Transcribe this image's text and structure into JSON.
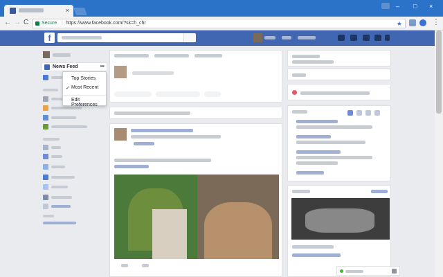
{
  "browser": {
    "close_glyph": "×",
    "url": "https://www.facebook.com/?sk=h_chr",
    "secure_label": "Secure",
    "separator": "|",
    "nav": {
      "back": "←",
      "forward": "→",
      "reload": "C"
    },
    "bookmark_glyph": "★",
    "menu_glyph": "⋮",
    "window_controls": {
      "minimize": "–",
      "maximize": "□",
      "close": "×"
    }
  },
  "facebook": {
    "logo_glyph": "f",
    "left_nav": {
      "news_feed_label": "News Feed",
      "news_feed_more": "•••"
    },
    "sort_menu": {
      "items": [
        {
          "label": "Top Stories",
          "checked": false
        },
        {
          "label": "Most Recent",
          "checked": true
        },
        {
          "label": "Edit Preferences",
          "checked": false
        }
      ],
      "check_glyph": "✓"
    }
  },
  "colors": {
    "fb_blue": "#4267b2",
    "chrome_blue": "#2a73c9",
    "page_bg": "#e9ebee"
  }
}
